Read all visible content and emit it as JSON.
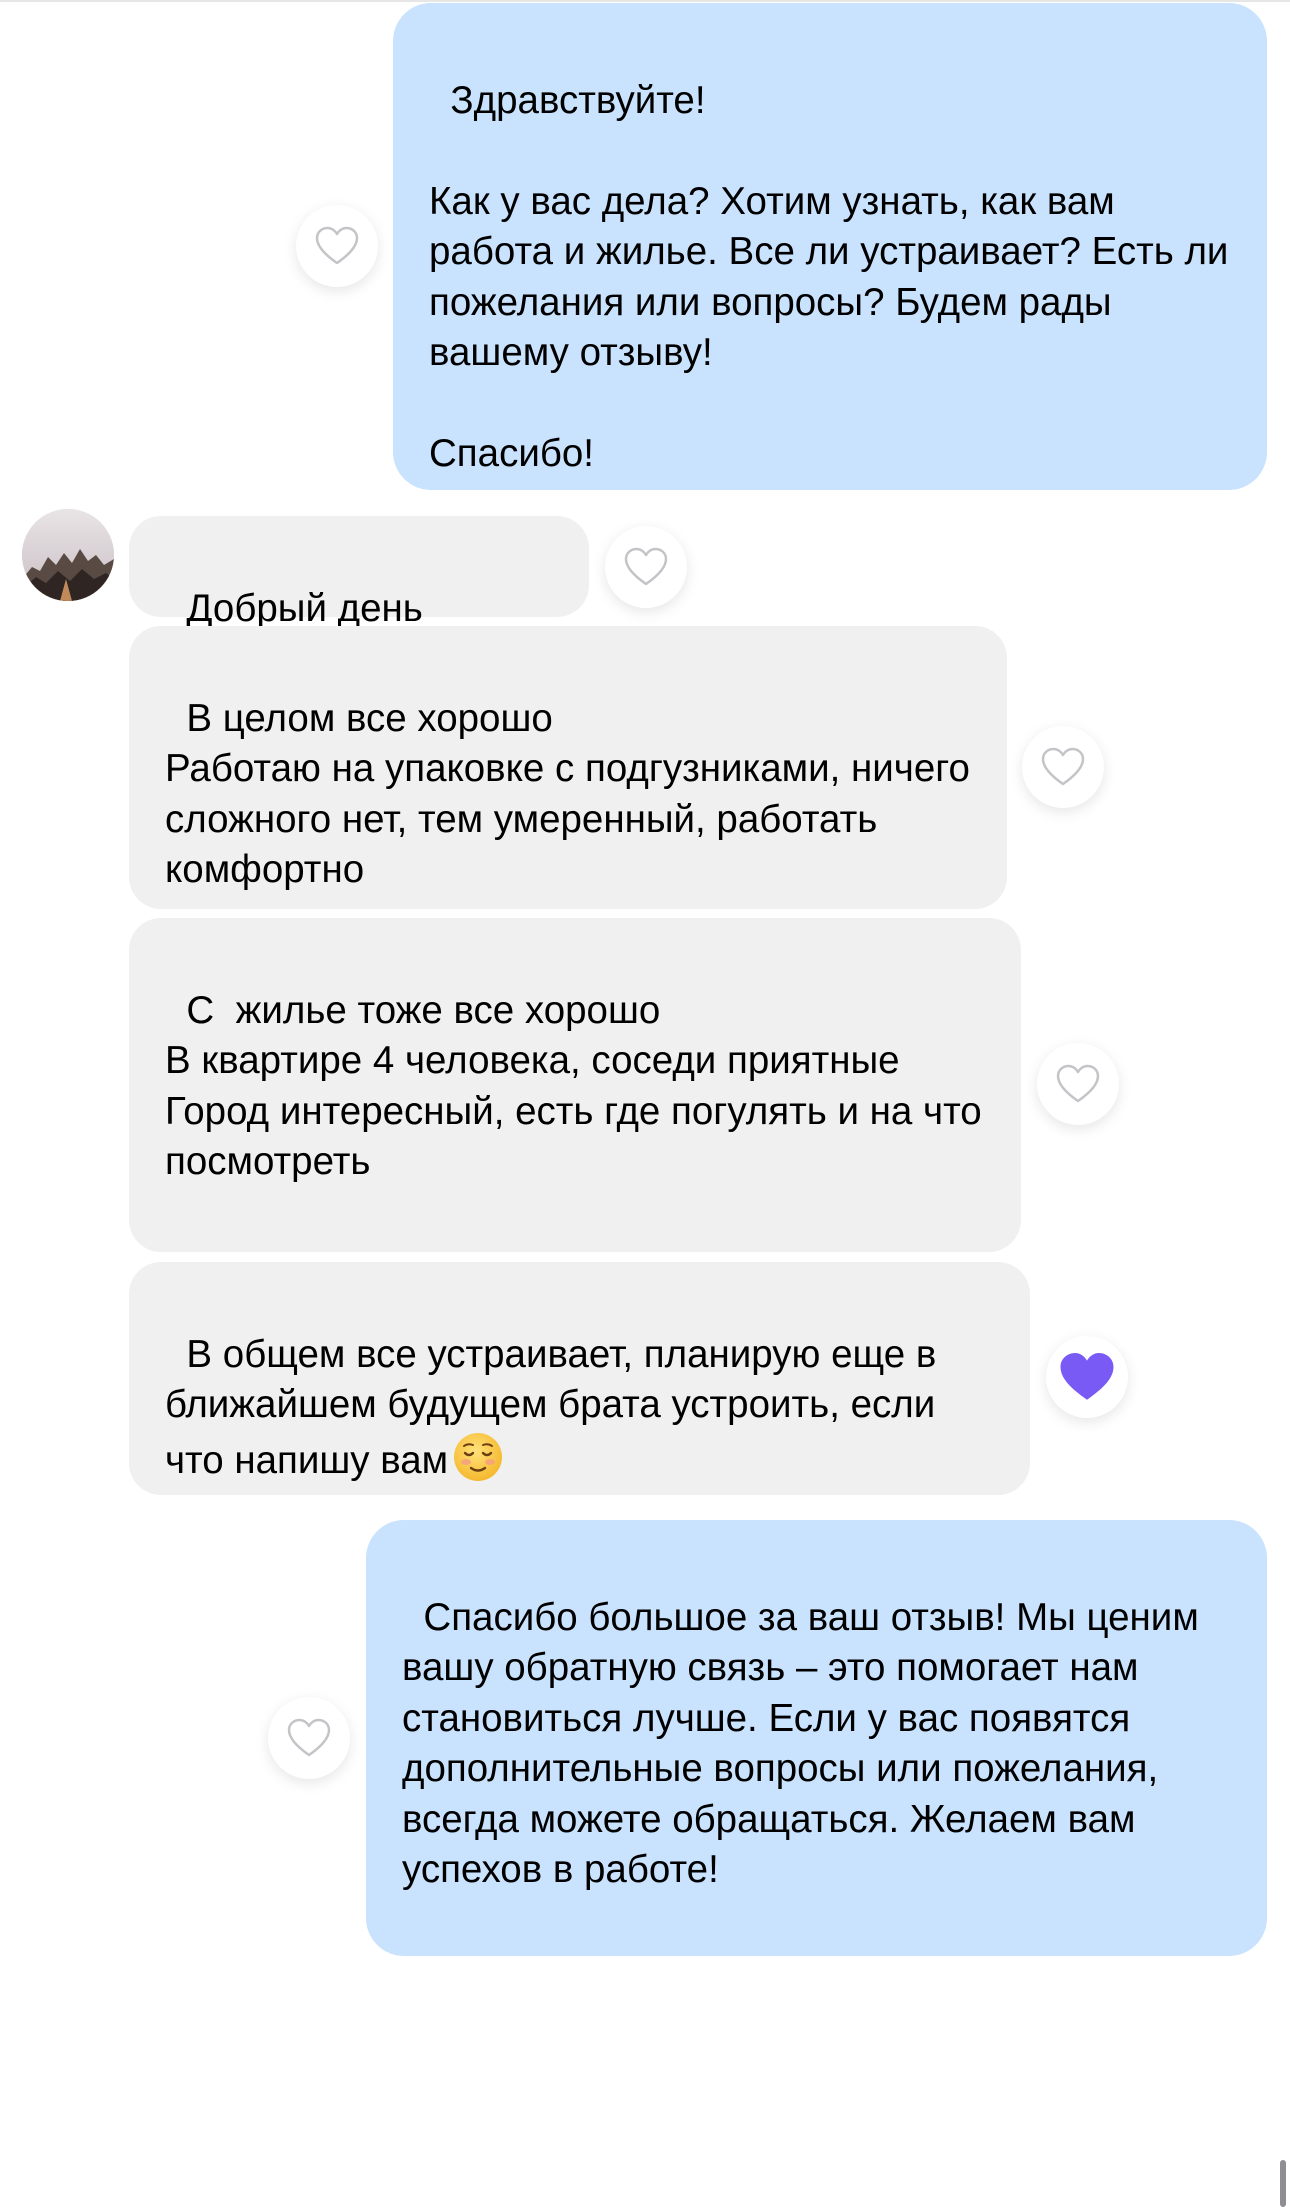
{
  "chat": {
    "messages": [
      {
        "direction": "outgoing",
        "text": "Здравствуйте!\n\nКак у вас дела? Хотим узнать, как вам работа и жилье. Все ли устраивает? Есть ли пожелания или вопросы? Будем рады вашему отзыву!\n\nСпасибо!",
        "liked": false
      },
      {
        "direction": "incoming",
        "text": "Добрый день",
        "liked": false
      },
      {
        "direction": "incoming",
        "text": "В целом все хорошо\nРаботаю на упаковке с подгузниками, ничего сложного нет, тем умеренный, работать комфортно",
        "liked": false
      },
      {
        "direction": "incoming",
        "text": "С  жилье тоже все хорошо\nВ квартире 4 человека, соседи приятные\nГород интересный, есть где погулять и на что посмотреть",
        "liked": false
      },
      {
        "direction": "incoming",
        "text": "В общем все устраивает, планирую еще в ближайшем будущем брата устроить, если что напишу вам",
        "emoji": "relieved-face-emoji",
        "liked": true
      },
      {
        "direction": "outgoing",
        "text": "Спасибо большое за ваш отзыв! Мы ценим вашу обратную связь – это помогает нам становиться лучше. Если у вас появятся дополнительные вопросы или пожелания, всегда можете обращаться. Желаем вам успехов в работе!",
        "liked": false
      }
    ]
  },
  "icons": {
    "like_empty": "heart-outline-icon",
    "like_filled": "heart-filled-icon",
    "avatar": "mountain-landscape-avatar"
  },
  "colors": {
    "outgoing_bubble": "#c9e2fd",
    "incoming_bubble": "#f0f0f0",
    "liked_heart": "#7a5af5",
    "heart_outline": "#c4c4c8"
  }
}
